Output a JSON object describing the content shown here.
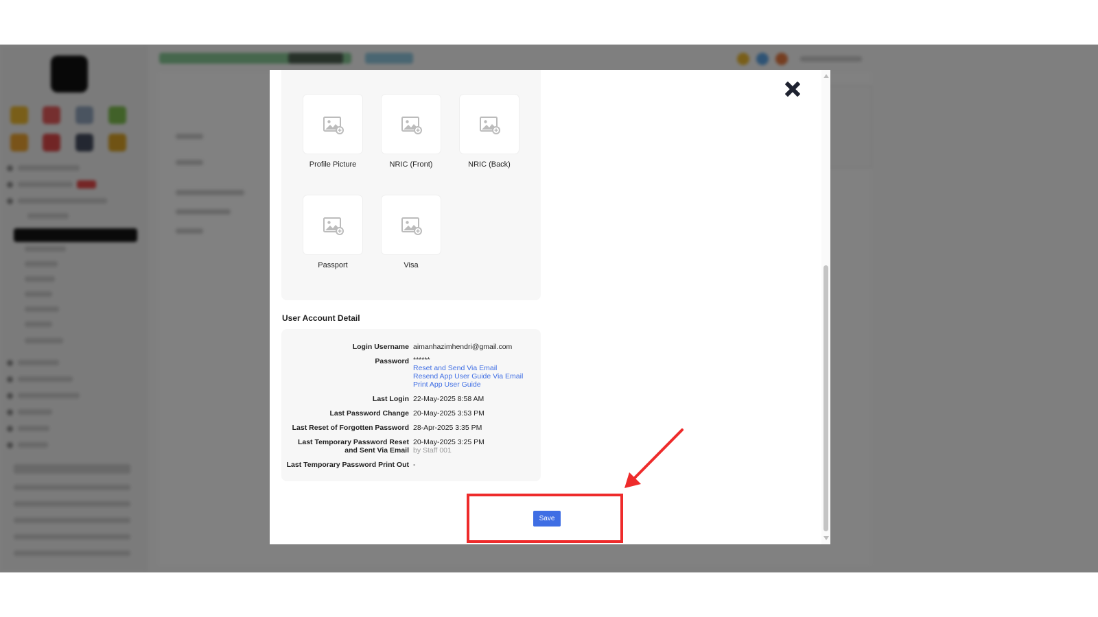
{
  "modal": {
    "attachments": [
      {
        "label": "Profile Picture",
        "icon": "image-placeholder-icon"
      },
      {
        "label": "NRIC (Front)",
        "icon": "image-placeholder-icon"
      },
      {
        "label": "NRIC (Back)",
        "icon": "image-placeholder-icon"
      },
      {
        "label": "Passport",
        "icon": "image-placeholder-icon"
      },
      {
        "label": "Visa",
        "icon": "image-placeholder-icon"
      }
    ],
    "section_title": "User Account Detail",
    "account": {
      "login_username_label": "Login Username",
      "login_username": "aimanhazimhendri@gmail.com",
      "password_label": "Password",
      "password_masked": "******",
      "reset_link": "Reset and Send Via Email",
      "resend_link": "Resend App User Guide Via Email",
      "print_link": "Print App User Guide",
      "last_login_label": "Last Login",
      "last_login": "22-May-2025 8:58 AM",
      "last_password_change_label": "Last Password Change",
      "last_password_change": "20-May-2025 3:53 PM",
      "last_reset_label": "Last Reset of Forgotten Password",
      "last_reset": "28-Apr-2025 3:35 PM",
      "last_temp_label_1": "Last Temporary Password Reset",
      "last_temp_label_2": "and Sent Via Email",
      "last_temp": "20-May-2025 3:25 PM",
      "last_temp_by": "by Staff 001",
      "last_print_label": "Last Temporary Password Print Out",
      "last_print": "-"
    },
    "save_label": "Save",
    "close_icon": "close-icon"
  },
  "colors": {
    "accent": "#3f6ee4",
    "annotation": "#ee2b2b",
    "overlay": "rgba(0,0,0,0.48)"
  }
}
